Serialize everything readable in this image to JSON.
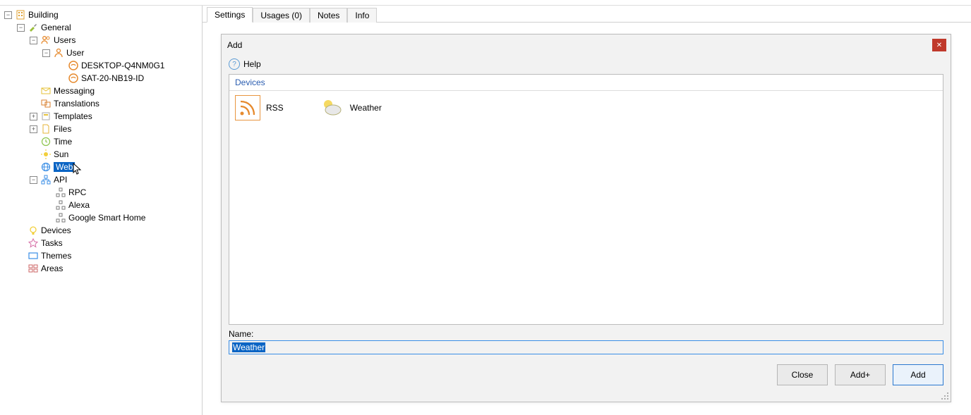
{
  "tree": {
    "building": "Building",
    "general": "General",
    "users": "Users",
    "user": "User",
    "desktop": "DESKTOP-Q4NM0G1",
    "sat": "SAT-20-NB19-ID",
    "messaging": "Messaging",
    "translations": "Translations",
    "templates": "Templates",
    "files": "Files",
    "time": "Time",
    "sun": "Sun",
    "web": "Web",
    "api": "API",
    "rpc": "RPC",
    "alexa": "Alexa",
    "gsh": "Google Smart Home",
    "devices": "Devices",
    "tasks": "Tasks",
    "themes": "Themes",
    "areas": "Areas"
  },
  "tabs": {
    "settings": "Settings",
    "usages": "Usages (0)",
    "notes": "Notes",
    "info": "Info"
  },
  "dialog": {
    "title": "Add",
    "help": "Help",
    "devices_header": "Devices",
    "item_rss": "RSS",
    "item_weather": "Weather",
    "name_label": "Name:",
    "name_value": "Weather",
    "btn_close": "Close",
    "btn_addplus": "Add+",
    "btn_add": "Add"
  }
}
